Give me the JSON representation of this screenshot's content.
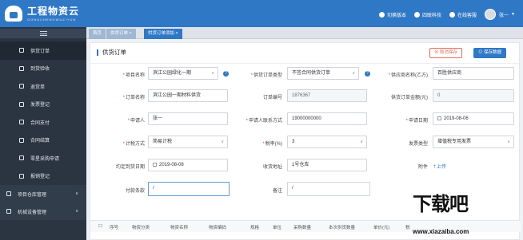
{
  "app": {
    "title": "工程物资云",
    "subtitle": "GONGCHENGWUZIYUN"
  },
  "topbar": {
    "links": [
      "切换版本",
      "四联科技",
      "在线客服"
    ],
    "user": "张一"
  },
  "sidebar": {
    "items": [
      {
        "label": "供货订单",
        "icon": "cart-icon"
      },
      {
        "label": "到货验收",
        "icon": "clipboard-icon"
      },
      {
        "label": "退货单",
        "icon": "document-icon"
      },
      {
        "label": "发票登记",
        "icon": "invoice-icon"
      },
      {
        "label": "合同支付",
        "icon": "folder-icon"
      },
      {
        "label": "合同结算",
        "icon": "settle-icon"
      },
      {
        "label": "零星采购申请",
        "icon": "chart-icon"
      },
      {
        "label": "报销登记",
        "icon": "receipt-icon"
      }
    ],
    "groups": [
      {
        "label": "项目仓库管理",
        "icon": "home-icon"
      },
      {
        "label": "机械设备管理",
        "icon": "gear-icon"
      }
    ]
  },
  "tabs": [
    {
      "label": "首页"
    },
    {
      "label": "供货订单 ×"
    },
    {
      "label": "供货订单添加 ×"
    }
  ],
  "panel": {
    "title": "供货订单",
    "cancel_label": "取消保存",
    "save_label": "保存数据"
  },
  "form": {
    "project_name": {
      "label": "项目名称",
      "value": "滨江公园绿化一期"
    },
    "order_type": {
      "label": "供货订单类型",
      "value": "不签合同供货订单"
    },
    "supplier": {
      "label": "供应商名称(乙方)",
      "value": "百胜供应商"
    },
    "order_name": {
      "label": "订单名称",
      "value": "滨江公园一期材料供货"
    },
    "order_no": {
      "label": "订单编号",
      "value": "1876367"
    },
    "order_amount": {
      "label": "供货订单金额(元)",
      "value": "0"
    },
    "applicant": {
      "label": "申请人",
      "value": "张一"
    },
    "contact": {
      "label": "申请人联系方式",
      "value": "19000000000"
    },
    "apply_date": {
      "label": "申请日期",
      "value": "2019-08-06"
    },
    "tax_method": {
      "label": "计税方式",
      "value": "简易计税"
    },
    "tax_rate": {
      "label": "税率(%)",
      "value": "3"
    },
    "invoice_type": {
      "label": "发票类型",
      "value": "增值税专用发票"
    },
    "arrival_date": {
      "label": "约定到货日期",
      "value": "2019-08-08"
    },
    "receive_addr": {
      "label": "收货地址",
      "value": "1号仓库"
    },
    "attachment": {
      "label": "附件",
      "value": "上传"
    },
    "payment_terms": {
      "label": "付款条款",
      "value": "/"
    },
    "remark": {
      "label": "备注",
      "value": "/"
    }
  },
  "table": {
    "headers": [
      "序号",
      "物资分类",
      "物资名称",
      "物资编码",
      "规格",
      "单位",
      "采购数量",
      "本次供货数量",
      "单价(元)",
      "税"
    ]
  },
  "watermark": {
    "text": "下载吧",
    "url": "www.xiazaiba.com"
  }
}
